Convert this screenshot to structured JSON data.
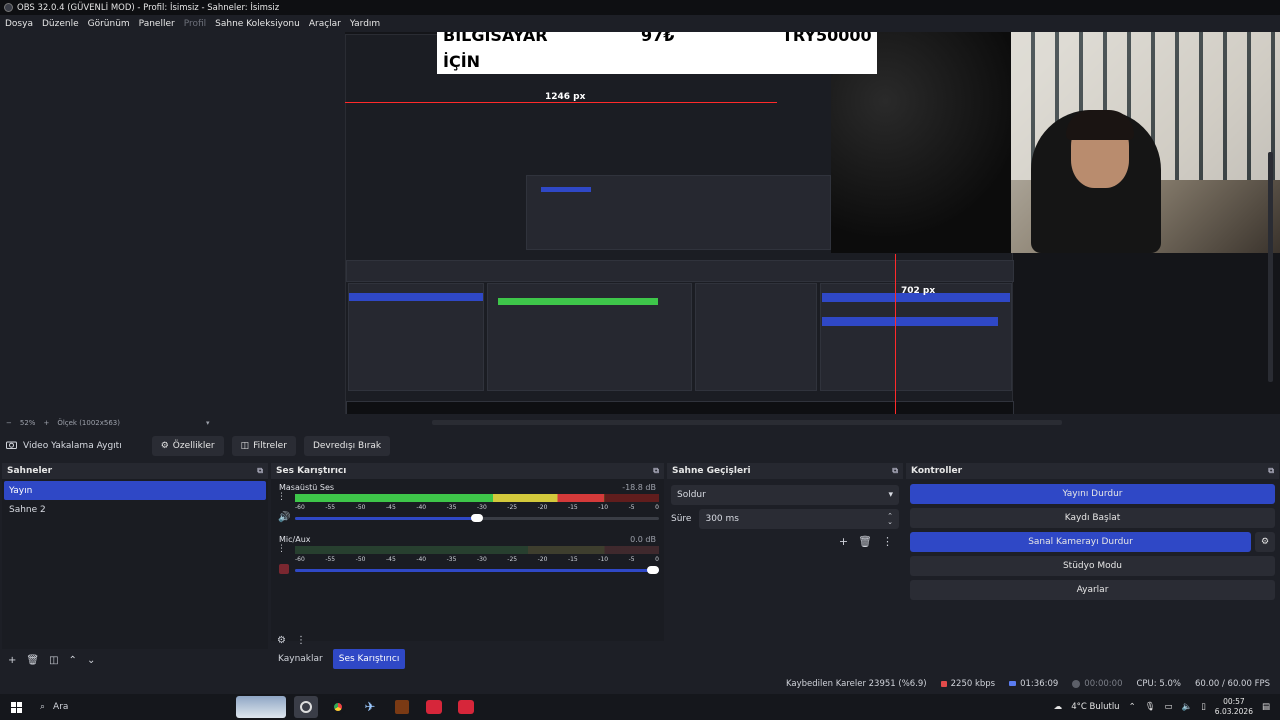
{
  "window": {
    "title": "OBS 32.0.4 (GÜVENLİ MOD) - Profil: İsimsiz - Sahneler: İsimsiz"
  },
  "menu": [
    {
      "label": "Dosya",
      "disabled": false
    },
    {
      "label": "Düzenle",
      "disabled": false
    },
    {
      "label": "Görünüm",
      "disabled": false
    },
    {
      "label": "Paneller",
      "disabled": false
    },
    {
      "label": "Profil",
      "disabled": true
    },
    {
      "label": "Sahne Koleksiyonu",
      "disabled": false
    },
    {
      "label": "Araçlar",
      "disabled": false
    },
    {
      "label": "Yardım",
      "disabled": false
    }
  ],
  "preview": {
    "banner": {
      "text1": "BİLGİSAYAR",
      "text2": "97₺",
      "text3": "TRY50000",
      "text4": "İÇİN"
    },
    "measure_h": "1246 px",
    "measure_v": "702 px"
  },
  "zoom": {
    "percent": "52%",
    "scale_label": "Ölçek (1002x563)"
  },
  "source_bar": {
    "source_name": "Video Yakalama Aygıtı",
    "properties": "Özellikler",
    "filters": "Filtreler",
    "deactivate": "Devredışı Bırak"
  },
  "scenes": {
    "title": "Sahneler",
    "items": [
      "Yayın",
      "Sahne 2"
    ],
    "active_index": 0
  },
  "mixer": {
    "title": "Ses Karıştırıcı",
    "ticks": [
      "-60",
      "-55",
      "-50",
      "-45",
      "-40",
      "-35",
      "-30",
      "-25",
      "-20",
      "-15",
      "-10",
      "-5",
      "0"
    ],
    "tracks": [
      {
        "name": "Masaüstü Ses",
        "db": "-18.8 dB",
        "level": 0.85,
        "volume": 0.5,
        "muted": false
      },
      {
        "name": "Mic/Aux",
        "db": "0.0 dB",
        "level": 0.0,
        "volume": 1.0,
        "muted": true
      }
    ]
  },
  "tabs": [
    {
      "label": "Kaynaklar",
      "active": false
    },
    {
      "label": "Ses Karıştırıcı",
      "active": true
    }
  ],
  "transitions": {
    "title": "Sahne Geçişleri",
    "selected": "Soldur",
    "duration_label": "Süre",
    "duration_value": "300 ms"
  },
  "controls": {
    "title": "Kontroller",
    "stop_stream": "Yayını Durdur",
    "start_record": "Kaydı Başlat",
    "stop_virtualcam": "Sanal Kamerayı Durdur",
    "studio_mode": "Stüdyo Modu",
    "settings": "Ayarlar"
  },
  "status": {
    "dropped": "Kaybedilen Kareler 23951 (%6.9)",
    "bitrate": "2250 kbps",
    "stream_time": "01:36:09",
    "record_time": "00:00:00",
    "cpu": "CPU: 5.0%",
    "fps": "60.00 / 60.00 FPS"
  },
  "taskbar": {
    "search_placeholder": "Ara",
    "weather": "4°C Bulutlu",
    "time": "00:57",
    "date": "6.03.2026"
  },
  "colors": {
    "accent": "#2f48c6",
    "panel": "#1d1f26",
    "titlebar": "#0e0f12"
  }
}
